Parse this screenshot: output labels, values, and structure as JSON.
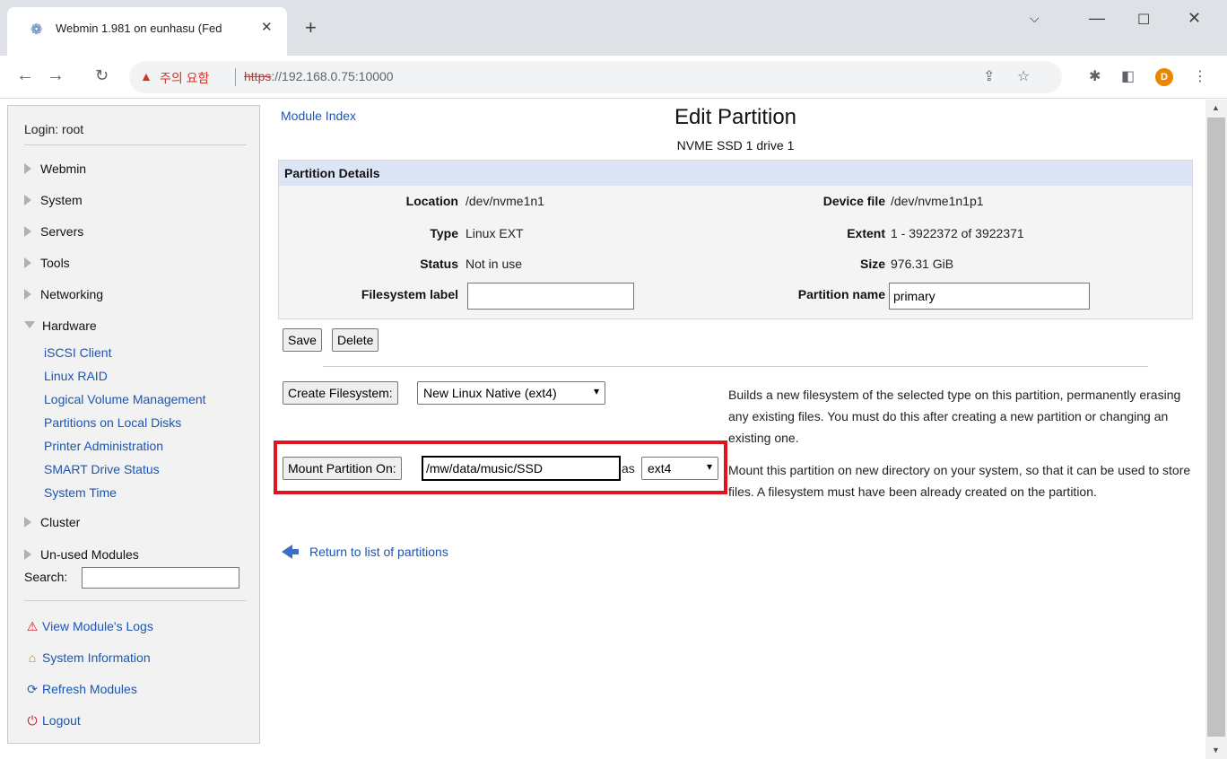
{
  "browser": {
    "tab_title": "Webmin 1.981 on eunhasu (Fed",
    "tab_close": "✕",
    "new_tab": "+",
    "security_label": "주의 요함",
    "url_scheme": "https",
    "url_rest": "://192.168.0.75:10000",
    "profile_initial": "D"
  },
  "sidebar": {
    "login": "Login: root",
    "categories": [
      {
        "label": "Webmin"
      },
      {
        "label": "System"
      },
      {
        "label": "Servers"
      },
      {
        "label": "Tools"
      },
      {
        "label": "Networking"
      },
      {
        "label": "Hardware"
      },
      {
        "label": "Cluster"
      },
      {
        "label": "Un-used Modules"
      }
    ],
    "hardware_items": [
      "iSCSI Client",
      "Linux RAID",
      "Logical Volume Management",
      "Partitions on Local Disks",
      "Printer Administration",
      "SMART Drive Status",
      "System Time"
    ],
    "search_label": "Search:",
    "bottom_links": [
      {
        "label": "View Module's Logs"
      },
      {
        "label": "System Information"
      },
      {
        "label": "Refresh Modules"
      },
      {
        "label": "Logout"
      }
    ]
  },
  "main": {
    "module_index": "Module Index",
    "title": "Edit Partition",
    "subtitle": "NVME SSD 1 drive 1",
    "details": {
      "header": "Partition Details",
      "location_label": "Location",
      "location_value": "/dev/nvme1n1",
      "device_label": "Device file",
      "device_value": "/dev/nvme1n1p1",
      "type_label": "Type",
      "type_value": "Linux EXT",
      "extent_label": "Extent",
      "extent_value": "1 - 3922372 of 3922371",
      "status_label": "Status",
      "status_value": "Not in use",
      "size_label": "Size",
      "size_value": "976.31 GiB",
      "fslabel_label": "Filesystem label",
      "fslabel_value": "",
      "pname_label": "Partition name",
      "pname_value": "primary"
    },
    "save_button": "Save",
    "delete_button": "Delete",
    "create_fs_button": "Create Filesystem:",
    "create_fs_select": "New Linux Native (ext4)",
    "create_fs_desc": "Builds a new filesystem of the selected type on this partition, permanently erasing any existing files. You must do this after creating a new partition or changing an existing one.",
    "mount_button": "Mount Partition On:",
    "mount_value": "/mw/data/music/SSD",
    "mount_as": "as",
    "mount_fs_select": "ext4",
    "mount_desc": "Mount this partition on new directory on your system, so that it can be used to store files. A filesystem must have been already created on the partition.",
    "return_link": "Return to list of partitions"
  }
}
